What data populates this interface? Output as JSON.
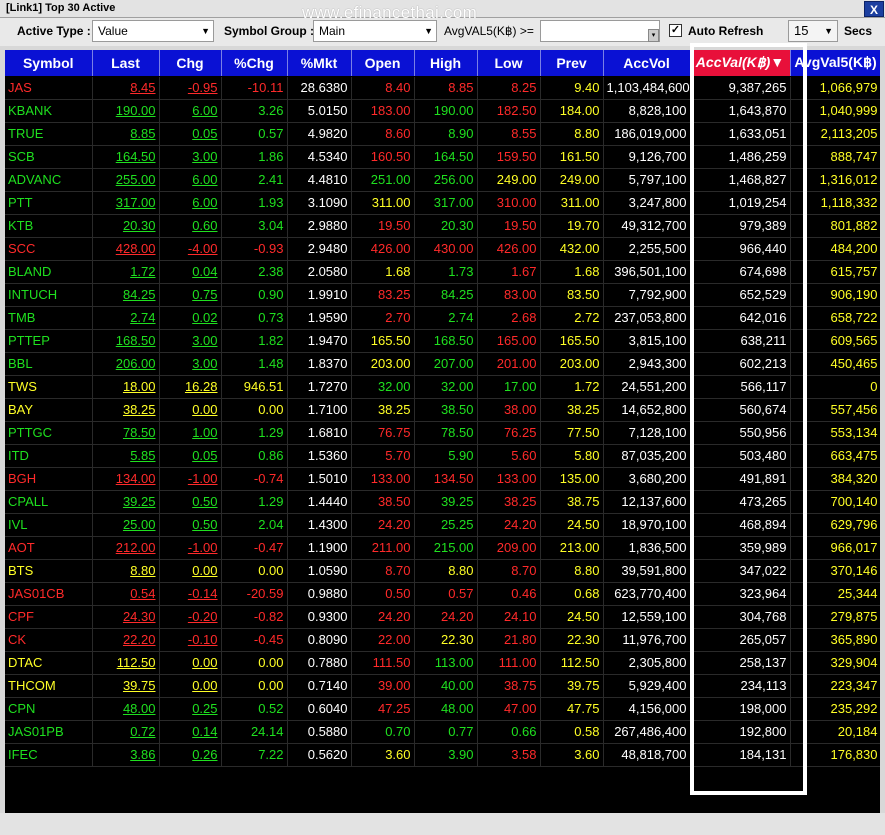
{
  "window": {
    "title": "[Link1] Top 30 Active",
    "close_label": "X",
    "watermark": "www.efinancethai.com"
  },
  "toolbar": {
    "active_type_label": "Active Type :",
    "active_type_value": "Value",
    "symbol_group_label": "Symbol Group :",
    "symbol_group_value": "Main",
    "avg_filter_label": "AvgVAL5(K฿) >=",
    "auto_refresh_label": "Auto Refresh",
    "auto_refresh_checked": "✓",
    "refresh_interval": "15",
    "secs_label": "Secs"
  },
  "columns": [
    "Symbol",
    "Last",
    "Chg",
    "%Chg",
    "%Mkt",
    "Open",
    "High",
    "Low",
    "Prev",
    "AccVol",
    "AccVal(K฿)",
    "AvgVal5(K฿)"
  ],
  "sort_indicator": "▼",
  "colors": {
    "header_bg": "#0a11d4",
    "active_header_bg": "#e8103a",
    "up": "#1fe01f",
    "down": "#ff2a2a",
    "flat": "#ffff26"
  },
  "rows": [
    {
      "symbol": "JAS",
      "last": "8.45",
      "chg": "-0.95",
      "pchg": "-10.11",
      "pmkt": "28.6380",
      "open": "8.40",
      "high": "8.85",
      "low": "8.25",
      "prev": "9.40",
      "accvol": "1,103,484,600",
      "accval": "9,387,265",
      "avgval": "1,066,979",
      "dir": "down",
      "open_c": "down",
      "high_c": "down",
      "low_c": "down"
    },
    {
      "symbol": "KBANK",
      "last": "190.00",
      "chg": "6.00",
      "pchg": "3.26",
      "pmkt": "5.0150",
      "open": "183.00",
      "high": "190.00",
      "low": "182.50",
      "prev": "184.00",
      "accvol": "8,828,100",
      "accval": "1,643,870",
      "avgval": "1,040,999",
      "dir": "up",
      "open_c": "down",
      "high_c": "up",
      "low_c": "down"
    },
    {
      "symbol": "TRUE",
      "last": "8.85",
      "chg": "0.05",
      "pchg": "0.57",
      "pmkt": "4.9820",
      "open": "8.60",
      "high": "8.90",
      "low": "8.55",
      "prev": "8.80",
      "accvol": "186,019,000",
      "accval": "1,633,051",
      "avgval": "2,113,205",
      "dir": "up",
      "open_c": "down",
      "high_c": "up",
      "low_c": "down"
    },
    {
      "symbol": "SCB",
      "last": "164.50",
      "chg": "3.00",
      "pchg": "1.86",
      "pmkt": "4.5340",
      "open": "160.50",
      "high": "164.50",
      "low": "159.50",
      "prev": "161.50",
      "accvol": "9,126,700",
      "accval": "1,486,259",
      "avgval": "888,747",
      "dir": "up",
      "open_c": "down",
      "high_c": "up",
      "low_c": "down"
    },
    {
      "symbol": "ADVANC",
      "last": "255.00",
      "chg": "6.00",
      "pchg": "2.41",
      "pmkt": "4.4810",
      "open": "251.00",
      "high": "256.00",
      "low": "249.00",
      "prev": "249.00",
      "accvol": "5,797,100",
      "accval": "1,468,827",
      "avgval": "1,316,012",
      "dir": "up",
      "open_c": "up",
      "high_c": "up",
      "low_c": "flat"
    },
    {
      "symbol": "PTT",
      "last": "317.00",
      "chg": "6.00",
      "pchg": "1.93",
      "pmkt": "3.1090",
      "open": "311.00",
      "high": "317.00",
      "low": "310.00",
      "prev": "311.00",
      "accvol": "3,247,800",
      "accval": "1,019,254",
      "avgval": "1,118,332",
      "dir": "up",
      "open_c": "flat",
      "high_c": "up",
      "low_c": "down"
    },
    {
      "symbol": "KTB",
      "last": "20.30",
      "chg": "0.60",
      "pchg": "3.04",
      "pmkt": "2.9880",
      "open": "19.50",
      "high": "20.30",
      "low": "19.50",
      "prev": "19.70",
      "accvol": "49,312,700",
      "accval": "979,389",
      "avgval": "801,882",
      "dir": "up",
      "open_c": "down",
      "high_c": "up",
      "low_c": "down"
    },
    {
      "symbol": "SCC",
      "last": "428.00",
      "chg": "-4.00",
      "pchg": "-0.93",
      "pmkt": "2.9480",
      "open": "426.00",
      "high": "430.00",
      "low": "426.00",
      "prev": "432.00",
      "accvol": "2,255,500",
      "accval": "966,440",
      "avgval": "484,200",
      "dir": "down",
      "open_c": "down",
      "high_c": "down",
      "low_c": "down"
    },
    {
      "symbol": "BLAND",
      "last": "1.72",
      "chg": "0.04",
      "pchg": "2.38",
      "pmkt": "2.0580",
      "open": "1.68",
      "high": "1.73",
      "low": "1.67",
      "prev": "1.68",
      "accvol": "396,501,100",
      "accval": "674,698",
      "avgval": "615,757",
      "dir": "up",
      "open_c": "flat",
      "high_c": "up",
      "low_c": "down"
    },
    {
      "symbol": "INTUCH",
      "last": "84.25",
      "chg": "0.75",
      "pchg": "0.90",
      "pmkt": "1.9910",
      "open": "83.25",
      "high": "84.25",
      "low": "83.00",
      "prev": "83.50",
      "accvol": "7,792,900",
      "accval": "652,529",
      "avgval": "906,190",
      "dir": "up",
      "open_c": "down",
      "high_c": "up",
      "low_c": "down"
    },
    {
      "symbol": "TMB",
      "last": "2.74",
      "chg": "0.02",
      "pchg": "0.73",
      "pmkt": "1.9590",
      "open": "2.70",
      "high": "2.74",
      "low": "2.68",
      "prev": "2.72",
      "accvol": "237,053,800",
      "accval": "642,016",
      "avgval": "658,722",
      "dir": "up",
      "open_c": "down",
      "high_c": "up",
      "low_c": "down"
    },
    {
      "symbol": "PTTEP",
      "last": "168.50",
      "chg": "3.00",
      "pchg": "1.82",
      "pmkt": "1.9470",
      "open": "165.50",
      "high": "168.50",
      "low": "165.00",
      "prev": "165.50",
      "accvol": "3,815,100",
      "accval": "638,211",
      "avgval": "609,565",
      "dir": "up",
      "open_c": "flat",
      "high_c": "up",
      "low_c": "down"
    },
    {
      "symbol": "BBL",
      "last": "206.00",
      "chg": "3.00",
      "pchg": "1.48",
      "pmkt": "1.8370",
      "open": "203.00",
      "high": "207.00",
      "low": "201.00",
      "prev": "203.00",
      "accvol": "2,943,300",
      "accval": "602,213",
      "avgval": "450,465",
      "dir": "up",
      "open_c": "flat",
      "high_c": "up",
      "low_c": "down"
    },
    {
      "symbol": "TWS",
      "last": "18.00",
      "chg": "16.28",
      "pchg": "946.51",
      "pmkt": "1.7270",
      "open": "32.00",
      "high": "32.00",
      "low": "17.00",
      "prev": "1.72",
      "accvol": "24,551,200",
      "accval": "566,117",
      "avgval": "0",
      "dir": "flat",
      "open_c": "up",
      "high_c": "up",
      "low_c": "up"
    },
    {
      "symbol": "BAY",
      "last": "38.25",
      "chg": "0.00",
      "pchg": "0.00",
      "pmkt": "1.7100",
      "open": "38.25",
      "high": "38.50",
      "low": "38.00",
      "prev": "38.25",
      "accvol": "14,652,800",
      "accval": "560,674",
      "avgval": "557,456",
      "dir": "flat",
      "open_c": "flat",
      "high_c": "up",
      "low_c": "down"
    },
    {
      "symbol": "PTTGC",
      "last": "78.50",
      "chg": "1.00",
      "pchg": "1.29",
      "pmkt": "1.6810",
      "open": "76.75",
      "high": "78.50",
      "low": "76.25",
      "prev": "77.50",
      "accvol": "7,128,100",
      "accval": "550,956",
      "avgval": "553,134",
      "dir": "up",
      "open_c": "down",
      "high_c": "up",
      "low_c": "down"
    },
    {
      "symbol": "ITD",
      "last": "5.85",
      "chg": "0.05",
      "pchg": "0.86",
      "pmkt": "1.5360",
      "open": "5.70",
      "high": "5.90",
      "low": "5.60",
      "prev": "5.80",
      "accvol": "87,035,200",
      "accval": "503,480",
      "avgval": "663,475",
      "dir": "up",
      "open_c": "down",
      "high_c": "up",
      "low_c": "down"
    },
    {
      "symbol": "BGH",
      "last": "134.00",
      "chg": "-1.00",
      "pchg": "-0.74",
      "pmkt": "1.5010",
      "open": "133.00",
      "high": "134.50",
      "low": "133.00",
      "prev": "135.00",
      "accvol": "3,680,200",
      "accval": "491,891",
      "avgval": "384,320",
      "dir": "down",
      "open_c": "down",
      "high_c": "down",
      "low_c": "down"
    },
    {
      "symbol": "CPALL",
      "last": "39.25",
      "chg": "0.50",
      "pchg": "1.29",
      "pmkt": "1.4440",
      "open": "38.50",
      "high": "39.25",
      "low": "38.25",
      "prev": "38.75",
      "accvol": "12,137,600",
      "accval": "473,265",
      "avgval": "700,140",
      "dir": "up",
      "open_c": "down",
      "high_c": "up",
      "low_c": "down"
    },
    {
      "symbol": "IVL",
      "last": "25.00",
      "chg": "0.50",
      "pchg": "2.04",
      "pmkt": "1.4300",
      "open": "24.20",
      "high": "25.25",
      "low": "24.20",
      "prev": "24.50",
      "accvol": "18,970,100",
      "accval": "468,894",
      "avgval": "629,796",
      "dir": "up",
      "open_c": "down",
      "high_c": "up",
      "low_c": "down"
    },
    {
      "symbol": "AOT",
      "last": "212.00",
      "chg": "-1.00",
      "pchg": "-0.47",
      "pmkt": "1.1900",
      "open": "211.00",
      "high": "215.00",
      "low": "209.00",
      "prev": "213.00",
      "accvol": "1,836,500",
      "accval": "359,989",
      "avgval": "966,017",
      "dir": "down",
      "open_c": "down",
      "high_c": "up",
      "low_c": "down"
    },
    {
      "symbol": "BTS",
      "last": "8.80",
      "chg": "0.00",
      "pchg": "0.00",
      "pmkt": "1.0590",
      "open": "8.70",
      "high": "8.80",
      "low": "8.70",
      "prev": "8.80",
      "accvol": "39,591,800",
      "accval": "347,022",
      "avgval": "370,146",
      "dir": "flat",
      "open_c": "down",
      "high_c": "flat",
      "low_c": "down"
    },
    {
      "symbol": "JAS01CB",
      "last": "0.54",
      "chg": "-0.14",
      "pchg": "-20.59",
      "pmkt": "0.9880",
      "open": "0.50",
      "high": "0.57",
      "low": "0.46",
      "prev": "0.68",
      "accvol": "623,770,400",
      "accval": "323,964",
      "avgval": "25,344",
      "dir": "down",
      "open_c": "down",
      "high_c": "down",
      "low_c": "down"
    },
    {
      "symbol": "CPF",
      "last": "24.30",
      "chg": "-0.20",
      "pchg": "-0.82",
      "pmkt": "0.9300",
      "open": "24.20",
      "high": "24.20",
      "low": "24.10",
      "prev": "24.50",
      "accvol": "12,559,100",
      "accval": "304,768",
      "avgval": "279,875",
      "dir": "down",
      "open_c": "down",
      "high_c": "down",
      "low_c": "down"
    },
    {
      "symbol": "CK",
      "last": "22.20",
      "chg": "-0.10",
      "pchg": "-0.45",
      "pmkt": "0.8090",
      "open": "22.00",
      "high": "22.30",
      "low": "21.80",
      "prev": "22.30",
      "accvol": "11,976,700",
      "accval": "265,057",
      "avgval": "365,890",
      "dir": "down",
      "open_c": "down",
      "high_c": "flat",
      "low_c": "down"
    },
    {
      "symbol": "DTAC",
      "last": "112.50",
      "chg": "0.00",
      "pchg": "0.00",
      "pmkt": "0.7880",
      "open": "111.50",
      "high": "113.00",
      "low": "111.00",
      "prev": "112.50",
      "accvol": "2,305,800",
      "accval": "258,137",
      "avgval": "329,904",
      "dir": "flat",
      "open_c": "down",
      "high_c": "up",
      "low_c": "down"
    },
    {
      "symbol": "THCOM",
      "last": "39.75",
      "chg": "0.00",
      "pchg": "0.00",
      "pmkt": "0.7140",
      "open": "39.00",
      "high": "40.00",
      "low": "38.75",
      "prev": "39.75",
      "accvol": "5,929,400",
      "accval": "234,113",
      "avgval": "223,347",
      "dir": "flat",
      "open_c": "down",
      "high_c": "up",
      "low_c": "down"
    },
    {
      "symbol": "CPN",
      "last": "48.00",
      "chg": "0.25",
      "pchg": "0.52",
      "pmkt": "0.6040",
      "open": "47.25",
      "high": "48.00",
      "low": "47.00",
      "prev": "47.75",
      "accvol": "4,156,000",
      "accval": "198,000",
      "avgval": "235,292",
      "dir": "up",
      "open_c": "down",
      "high_c": "up",
      "low_c": "down"
    },
    {
      "symbol": "JAS01PB",
      "last": "0.72",
      "chg": "0.14",
      "pchg": "24.14",
      "pmkt": "0.5880",
      "open": "0.70",
      "high": "0.77",
      "low": "0.66",
      "prev": "0.58",
      "accvol": "267,486,400",
      "accval": "192,800",
      "avgval": "20,184",
      "dir": "up",
      "open_c": "up",
      "high_c": "up",
      "low_c": "up"
    },
    {
      "symbol": "IFEC",
      "last": "3.86",
      "chg": "0.26",
      "pchg": "7.22",
      "pmkt": "0.5620",
      "open": "3.60",
      "high": "3.90",
      "low": "3.58",
      "prev": "3.60",
      "accvol": "48,818,700",
      "accval": "184,131",
      "avgval": "176,830",
      "dir": "up",
      "open_c": "flat",
      "high_c": "up",
      "low_c": "down"
    }
  ]
}
